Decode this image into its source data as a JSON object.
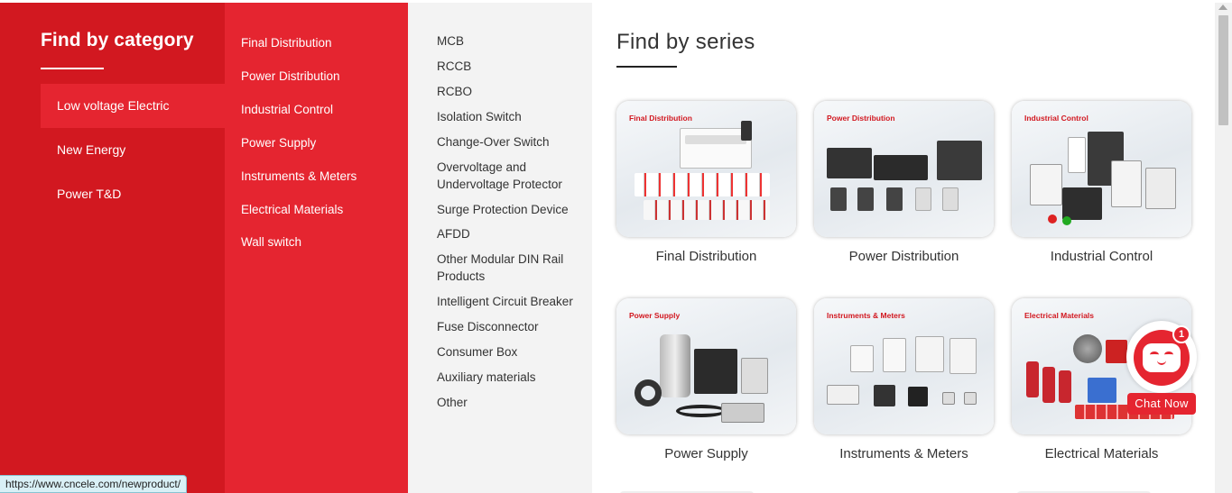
{
  "category": {
    "title": "Find by category",
    "items": [
      {
        "label": "Low voltage Electric",
        "active": true
      },
      {
        "label": "New Energy",
        "active": false
      },
      {
        "label": "Power T&D",
        "active": false
      }
    ]
  },
  "subcategories": {
    "items": [
      "Final Distribution",
      "Power Distribution",
      "Industrial Control",
      "Power Supply",
      "Instruments & Meters",
      "Electrical Materials",
      "Wall switch"
    ]
  },
  "products": {
    "items": [
      "MCB",
      "RCCB",
      "RCBO",
      "Isolation Switch",
      "Change-Over Switch",
      "Overvoltage and Undervoltage Protector",
      "Surge Protection Device",
      "AFDD",
      "Other Modular DIN Rail Products",
      "Intelligent Circuit Breaker",
      "Fuse Disconnector",
      "Consumer Box",
      "Auxiliary materials",
      "Other"
    ]
  },
  "series": {
    "title": "Find by series",
    "cards": [
      {
        "tag": "Final Distribution",
        "label": "Final Distribution"
      },
      {
        "tag": "Power Distribution",
        "label": "Power Distribution"
      },
      {
        "tag": "Industrial Control",
        "label": "Industrial Control"
      },
      {
        "tag": "Power Supply",
        "label": "Power Supply"
      },
      {
        "tag": "Instruments & Meters",
        "label": "Instruments & Meters"
      },
      {
        "tag": "Electrical Materials",
        "label": "Electrical Materials"
      }
    ]
  },
  "chat": {
    "badge": "1",
    "label": "Chat Now"
  },
  "status": {
    "url": "https://www.cncele.com/newproduct/"
  },
  "colors": {
    "brand_red": "#d21820",
    "accent_red": "#e52530",
    "panel_grey": "#f3f3f3"
  }
}
